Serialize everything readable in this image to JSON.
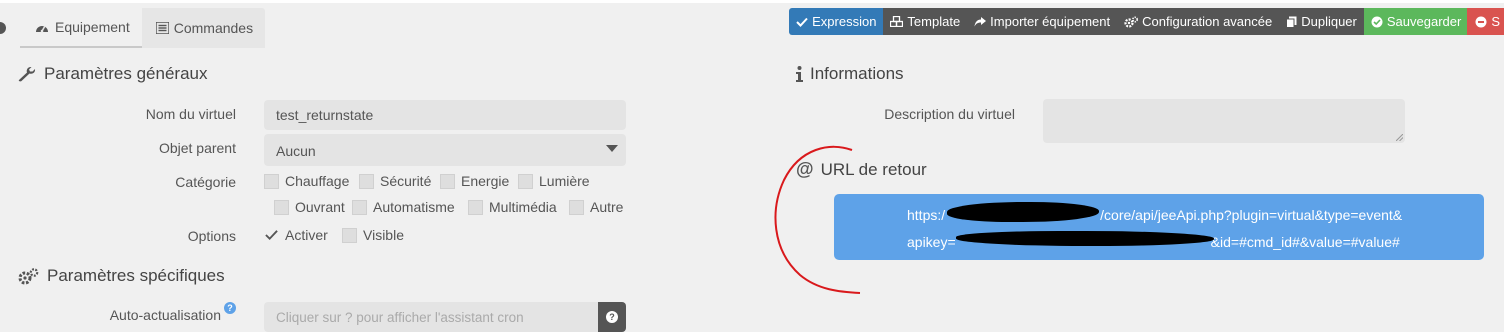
{
  "tabs": [
    {
      "label": "Equipement",
      "icon": "dashboard-icon",
      "active": true
    },
    {
      "label": "Commandes",
      "icon": "list-icon",
      "active": false
    }
  ],
  "actions": {
    "expression": "Expression",
    "template": "Template",
    "import": "Importer équipement",
    "config": "Configuration avancée",
    "duplicate": "Dupliquer",
    "save": "Sauvegarder",
    "delete": "S"
  },
  "general": {
    "title": "Paramètres généraux",
    "name_label": "Nom du virtuel",
    "name_value": "test_returnstate",
    "parent_label": "Objet parent",
    "parent_value": "Aucun",
    "category_label": "Catégorie",
    "categories": [
      "Chauffage",
      "Sécurité",
      "Energie",
      "Lumière",
      "Ouvrant",
      "Automatisme",
      "Multimédia",
      "Autre"
    ],
    "options_label": "Options",
    "options": [
      {
        "label": "Activer",
        "checked": true
      },
      {
        "label": "Visible",
        "checked": false
      }
    ]
  },
  "specific": {
    "title": "Paramètres spécifiques",
    "auto_label": "Auto-actualisation",
    "auto_placeholder": "Cliquer sur ? pour afficher l'assistant cron"
  },
  "info": {
    "title": "Informations",
    "desc_label": "Description du virtuel"
  },
  "return_url": {
    "title": "URL de retour",
    "line1_start": "https:/",
    "line1_end": "/core/api/jeeApi.php?plugin=virtual&type=event&",
    "line2_start": "apikey=",
    "line2_end": "&id=#cmd_id#&value=#value#"
  },
  "colors": {
    "expression": "#337ab7",
    "save": "#5cb85c",
    "delete": "#d9534f",
    "url_box": "#5ea2e8",
    "annotation": "#d9191c"
  }
}
